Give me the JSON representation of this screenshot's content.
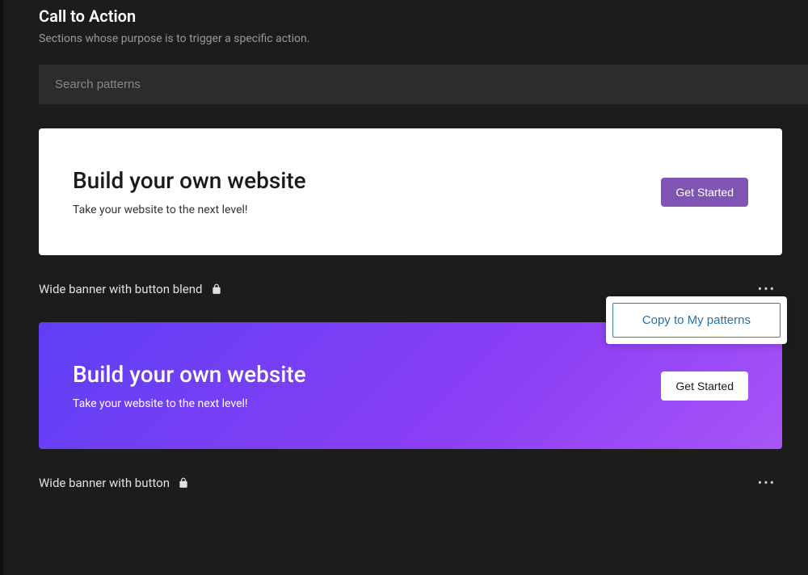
{
  "header": {
    "title": "Call to Action",
    "subtitle": "Sections whose purpose is to trigger a specific action."
  },
  "search": {
    "placeholder": "Search patterns"
  },
  "patterns": [
    {
      "title": "Build your own website",
      "subtitle": "Take your website to the next level!",
      "button_label": "Get Started",
      "label": "Wide banner with button blend"
    },
    {
      "title": "Build your own website",
      "subtitle": "Take your website to the next level!",
      "button_label": "Get Started",
      "label": "Wide banner with button"
    }
  ],
  "popover": {
    "copy_label": "Copy to My patterns"
  }
}
